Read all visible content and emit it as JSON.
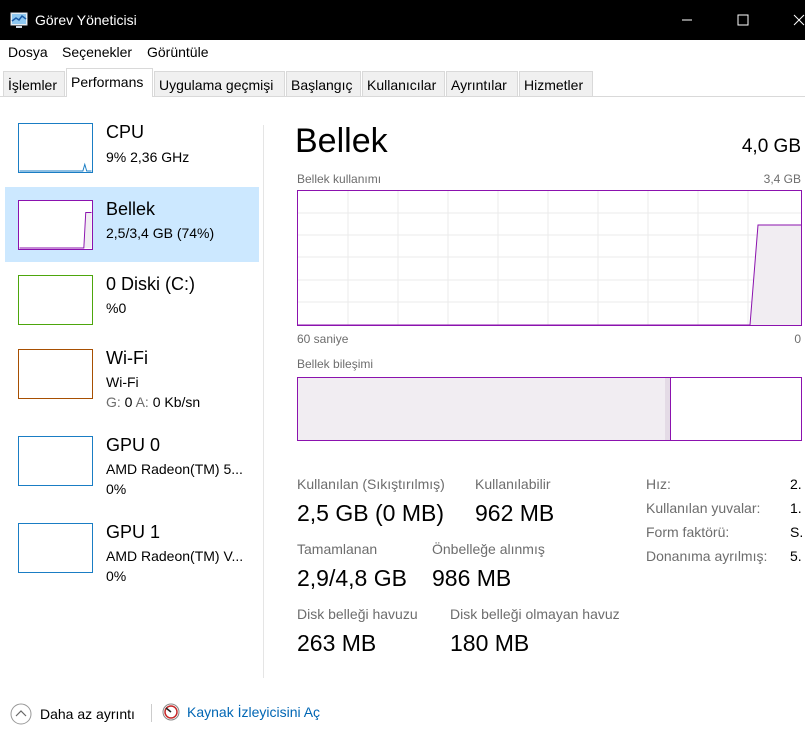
{
  "window": {
    "title": "Görev Yöneticisi"
  },
  "menu": [
    "Dosya",
    "Seçenekler",
    "Görüntüle"
  ],
  "tabs": [
    "İşlemler",
    "Performans",
    "Uygulama geçmişi",
    "Başlangıç",
    "Kullanıcılar",
    "Ayrıntılar",
    "Hizmetler"
  ],
  "active_tab": "Performans",
  "resources": [
    {
      "title": "CPU",
      "line1": "9%  2,36 GHz",
      "color": "#1a7dc4"
    },
    {
      "title": "Bellek",
      "line1": "2,5/3,4 GB (74%)",
      "color": "#8b12ae",
      "selected": true
    },
    {
      "title": "0 Diski (C:)",
      "line1": "%0",
      "color": "#4da60c"
    },
    {
      "title": "Wi-Fi",
      "line1": "Wi-Fi",
      "line2_s_label": "G:",
      "line2_s_value": "0",
      "line2_r_label": "A:",
      "line2_r_value": "0 Kb/sn",
      "color": "#a74f01"
    },
    {
      "title": "GPU 0",
      "line1": "AMD Radeon(TM) 5...",
      "line2": "0%",
      "color": "#1a7dc4"
    },
    {
      "title": "GPU 1",
      "line1": "AMD Radeon(TM) V...",
      "line2": "0%",
      "color": "#1a7dc4"
    }
  ],
  "detail": {
    "title": "Bellek",
    "total": "4,0 GB",
    "graph_label": "Bellek kullanımı",
    "graph_max": "3,4 GB",
    "graph_time": "60 saniye",
    "graph_zero": "0",
    "composition_label": "Bellek bileşimi",
    "usage_fraction": 0.74,
    "in_use_fraction_of_bar": 0.73,
    "stats": {
      "in_use_label": "Kullanılan (Sıkıştırılmış)",
      "in_use_value": "2,5 GB (0 MB)",
      "available_label": "Kullanılabilir",
      "available_value": "962 MB",
      "committed_label": "Tamamlanan",
      "committed_value": "2,9/4,8 GB",
      "cached_label": "Önbelleğe alınmış",
      "cached_value": "986 MB",
      "paged_label": "Disk belleği havuzu",
      "paged_value": "263 MB",
      "nonpaged_label": "Disk belleği olmayan havuz",
      "nonpaged_value": "180 MB"
    },
    "right": [
      {
        "label": "Hız:",
        "value": "2."
      },
      {
        "label": "Kullanılan yuvalar:",
        "value": "1."
      },
      {
        "label": "Form faktörü:",
        "value": "S."
      },
      {
        "label": "Donanıma ayrılmış:",
        "value": "5."
      }
    ]
  },
  "bottom": {
    "fewer_details": "Daha az ayrıntı",
    "resource_monitor": "Kaynak İzleyicisini Aç"
  },
  "colors": {
    "memory": "#8b12ae",
    "memory_fill": "#f1edf2",
    "selected": "#cce8ff",
    "link": "#0066b4"
  }
}
